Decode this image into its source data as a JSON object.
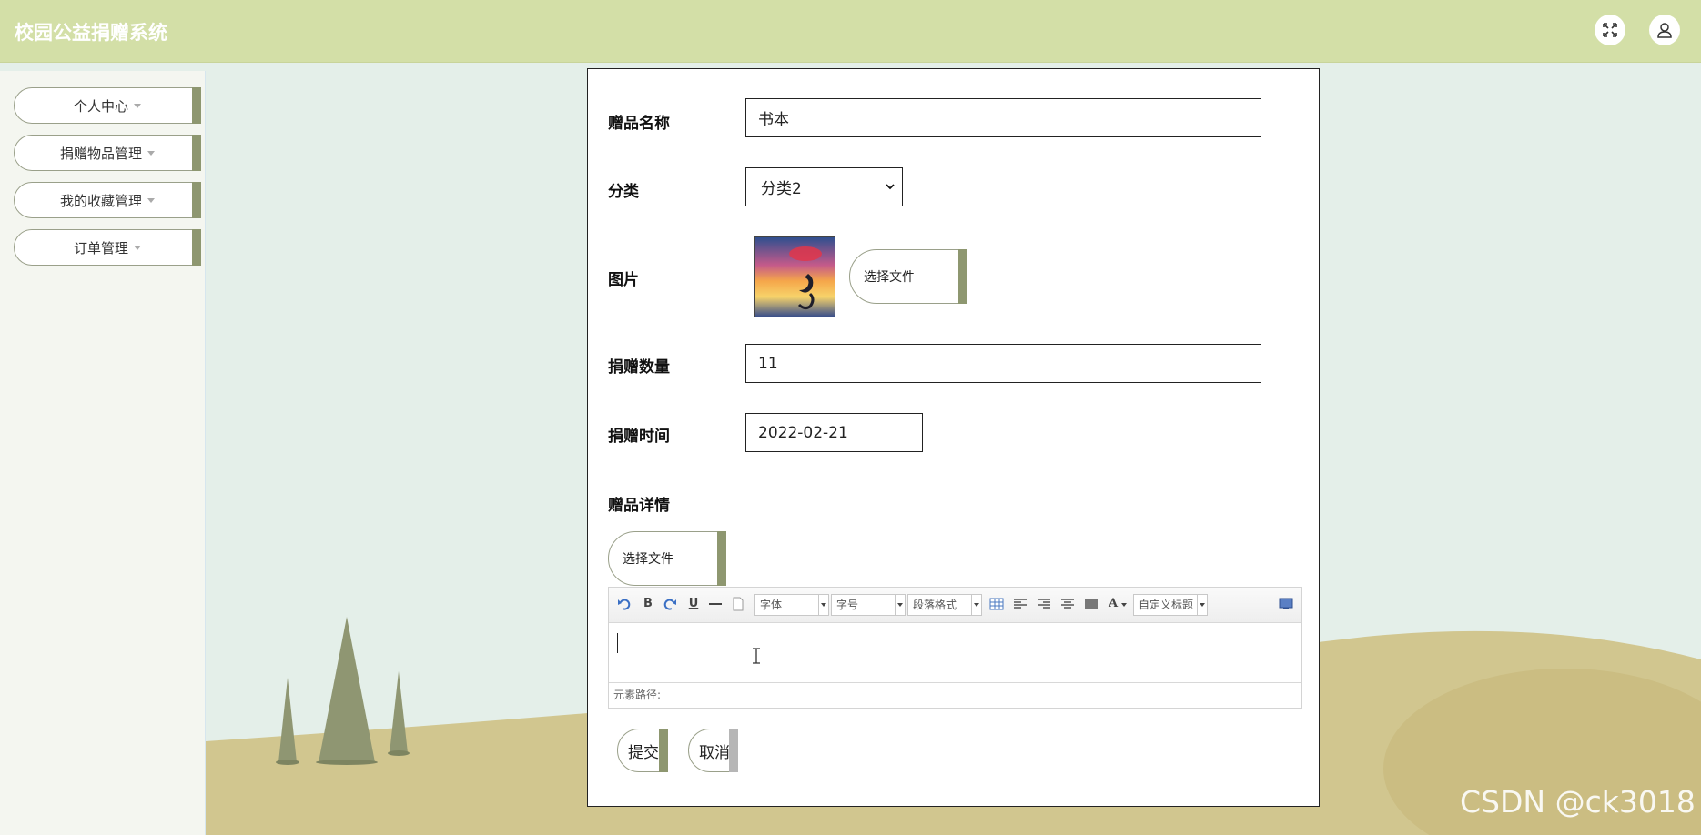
{
  "header": {
    "title": "校园公益捐赠系统",
    "fullscreen_icon": "expand-icon",
    "user_icon": "user-icon"
  },
  "sidebar": {
    "items": [
      {
        "label": "个人中心"
      },
      {
        "label": "捐赠物品管理"
      },
      {
        "label": "我的收藏管理"
      },
      {
        "label": "订单管理"
      }
    ]
  },
  "form": {
    "name_label": "赠品名称",
    "name_value": "书本",
    "category_label": "分类",
    "category_value": "分类2",
    "image_label": "图片",
    "image_file_button": "选择文件",
    "quantity_label": "捐赠数量",
    "quantity_value": "11",
    "date_label": "捐赠时间",
    "date_value": "2022-02-21",
    "detail_label": "赠品详情",
    "detail_file_button": "选择文件"
  },
  "editor": {
    "font_combo": "字体",
    "size_combo": "字号",
    "paragraph_combo": "段落格式",
    "custom_title_combo": "自定义标题",
    "status_path": "元素路径:"
  },
  "actions": {
    "submit": "提交",
    "cancel": "取消"
  },
  "watermark": "CSDN @ck3018",
  "colors": {
    "header_bg": "#d3dfa7",
    "accent": "#8e9770",
    "page_bg": "#e4efe9"
  }
}
